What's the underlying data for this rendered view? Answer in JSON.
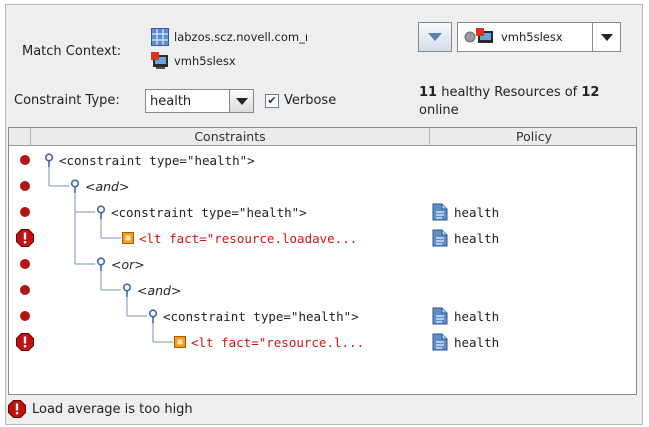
{
  "match_context": {
    "label": "Match Context:",
    "items": [
      {
        "text": "labzos.scz.novell.com_ı",
        "icon": "grid-icon"
      },
      {
        "text": "vmh5slesx",
        "icon": "vm-host-icon"
      }
    ]
  },
  "target_selector": {
    "value": "vmh5slesx",
    "icon": "vm-host-icon"
  },
  "constraint_type": {
    "label": "Constraint Type:",
    "value": "health"
  },
  "verbose": {
    "label": "Verbose",
    "checked": true,
    "mark": "✔"
  },
  "summary": {
    "count": "11",
    "text1": " healthy Resources of ",
    "total": "12",
    "text2": "online"
  },
  "table": {
    "columns": [
      "Constraints",
      "Policy"
    ],
    "rows": [
      {
        "status": "ok",
        "text": "<constraint type=\"health\">",
        "node": "element",
        "style": "normal",
        "policy": ""
      },
      {
        "status": "ok",
        "text": "<and>",
        "node": "element",
        "style": "italic",
        "policy": ""
      },
      {
        "status": "ok",
        "text": "<constraint type=\"health\">",
        "node": "element",
        "style": "normal",
        "policy": "health"
      },
      {
        "status": "error",
        "text": "<lt fact=\"resource.loadave...",
        "node": "fact",
        "style": "red",
        "policy": "health"
      },
      {
        "status": "ok",
        "text": "<or>",
        "node": "element",
        "style": "italic",
        "policy": ""
      },
      {
        "status": "ok",
        "text": "<and>",
        "node": "element",
        "style": "italic",
        "policy": ""
      },
      {
        "status": "ok",
        "text": "<constraint type=\"health\">",
        "node": "element",
        "style": "normal",
        "policy": "health"
      },
      {
        "status": "error",
        "text": "<lt fact=\"resource.l...",
        "node": "fact",
        "style": "red",
        "policy": "health"
      }
    ]
  },
  "status_message": "Load average is too high",
  "colors": {
    "error": "#e01010",
    "ok_dot": "#b51212",
    "tree_line": "#7a93b8"
  }
}
